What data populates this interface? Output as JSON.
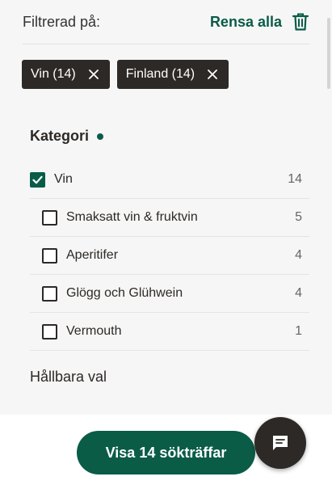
{
  "filter_header": {
    "label": "Filtrerad på:",
    "clear_all": "Rensa alla",
    "clear_icon": "trash-icon"
  },
  "chips": [
    {
      "label": "Vin (14)",
      "icon": "close-icon"
    },
    {
      "label": "Finland (14)",
      "icon": "close-icon"
    }
  ],
  "category": {
    "heading": "Kategori",
    "items": [
      {
        "label": "Vin",
        "count": "14",
        "checked": true
      },
      {
        "label": "Smaksatt vin & fruktvin",
        "count": "5",
        "checked": false
      },
      {
        "label": "Aperitifer",
        "count": "4",
        "checked": false
      },
      {
        "label": "Glögg och Glühwein",
        "count": "4",
        "checked": false
      },
      {
        "label": "Vermouth",
        "count": "1",
        "checked": false
      }
    ]
  },
  "sustainable": {
    "label": "Hållbara val"
  },
  "footer": {
    "show_results": "Visa 14 sökträffar",
    "chat_icon": "chat-icon"
  },
  "colors": {
    "accent": "#0a5c47",
    "dark": "#2d2926",
    "background": "#f6f6f6"
  }
}
